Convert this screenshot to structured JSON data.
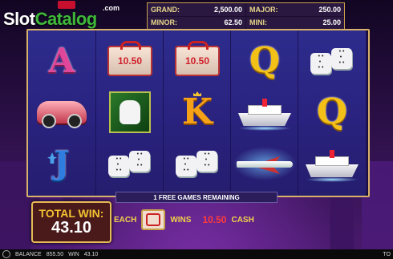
{
  "logo": {
    "brand_primary": "Slot",
    "brand_secondary": "Catalog",
    "domain": ".com"
  },
  "jackpots": [
    {
      "label": "GRAND:",
      "value": "2,500.00"
    },
    {
      "label": "MAJOR:",
      "value": "250.00"
    },
    {
      "label": "MINOR:",
      "value": "62.50"
    },
    {
      "label": "MINI:",
      "value": "25.00"
    }
  ],
  "reels": [
    [
      {
        "type": "letter",
        "glyph": "A",
        "icon": "letter-a-icon"
      },
      {
        "type": "car",
        "icon": "car-icon"
      },
      {
        "type": "letter",
        "glyph": "J",
        "icon": "letter-j-icon"
      }
    ],
    [
      {
        "type": "cash",
        "amount": "10.50",
        "icon": "cash-register-icon"
      },
      {
        "type": "dog",
        "icon": "dog-icon"
      },
      {
        "type": "dice",
        "icon": "dice-icon"
      }
    ],
    [
      {
        "type": "cash",
        "amount": "10.50",
        "icon": "cash-register-icon"
      },
      {
        "type": "letter",
        "glyph": "K",
        "icon": "letter-k-icon"
      },
      {
        "type": "dice",
        "icon": "dice-icon"
      }
    ],
    [
      {
        "type": "letter",
        "glyph": "Q",
        "icon": "letter-q-icon"
      },
      {
        "type": "ship",
        "icon": "yacht-icon"
      },
      {
        "type": "plane",
        "icon": "airplane-icon"
      }
    ],
    [
      {
        "type": "dice",
        "icon": "dice-icon"
      },
      {
        "type": "letter",
        "glyph": "Q",
        "icon": "letter-q-icon"
      },
      {
        "type": "ship",
        "icon": "yacht-icon"
      }
    ]
  ],
  "banner": "1 FREE GAMES REMAINING",
  "total_win": {
    "label": "TOTAL WIN:",
    "value": "43.10"
  },
  "each_row": {
    "each": "EACH",
    "wins": "WINS",
    "amount": "10.50",
    "cash": "CASH"
  },
  "status": {
    "balance_label": "BALANCE",
    "balance": "855.50",
    "win_label": "WIN",
    "win": "43.10",
    "total_label": "TO"
  },
  "colors": {
    "frame": "#d8b26a",
    "reel_bg": "#2a2380",
    "gold": "#f2c232",
    "cash_red": "#ff3b3b"
  }
}
